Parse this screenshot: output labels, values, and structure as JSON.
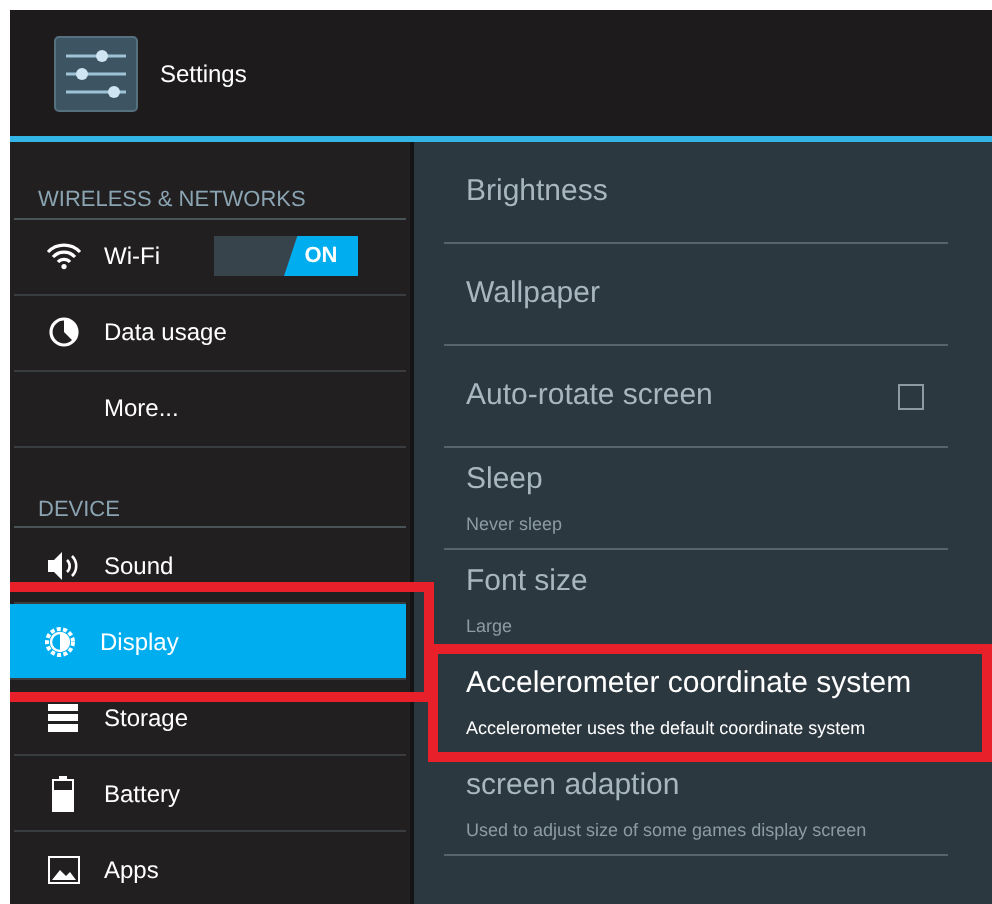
{
  "header": {
    "title": "Settings"
  },
  "sidebar": {
    "sections": [
      {
        "heading": "WIRELESS & NETWORKS",
        "items": [
          {
            "kind": "toggle",
            "label": "Wi-Fi",
            "selected": false,
            "highlighted": false,
            "toggle": {
              "on": true,
              "label": "ON"
            }
          },
          {
            "kind": "plain",
            "label": "Data usage",
            "selected": false,
            "highlighted": false
          },
          {
            "kind": "plain",
            "label": "More...",
            "selected": false,
            "highlighted": false
          }
        ]
      },
      {
        "heading": "DEVICE",
        "items": [
          {
            "kind": "plain",
            "label": "Sound",
            "selected": false,
            "highlighted": false
          },
          {
            "kind": "plain",
            "label": "Display",
            "selected": true,
            "highlighted": true
          },
          {
            "kind": "plain",
            "label": "Storage",
            "selected": false,
            "highlighted": false
          },
          {
            "kind": "plain",
            "label": "Battery",
            "selected": false,
            "highlighted": false
          },
          {
            "kind": "plain",
            "label": "Apps",
            "selected": false,
            "highlighted": false
          }
        ]
      }
    ]
  },
  "display_settings": [
    {
      "kind": "plain",
      "title": "Brightness",
      "active": false,
      "highlighted": false
    },
    {
      "kind": "plain",
      "title": "Wallpaper",
      "active": false,
      "highlighted": false
    },
    {
      "kind": "checkbox",
      "title": "Auto-rotate screen",
      "checked": false,
      "active": false,
      "highlighted": false
    },
    {
      "kind": "plain",
      "title": "Sleep",
      "summary": "Never sleep",
      "active": false,
      "highlighted": false
    },
    {
      "kind": "plain",
      "title": "Font size",
      "summary": "Large",
      "active": false,
      "highlighted": false
    },
    {
      "kind": "plain",
      "title": "Accelerometer coordinate system",
      "summary": "Accelerometer uses the default coordinate system",
      "active": true,
      "highlighted": true
    },
    {
      "kind": "plain",
      "title": "screen adaption",
      "summary": "Used to adjust size of some games display screen",
      "active": false,
      "highlighted": false
    }
  ]
}
